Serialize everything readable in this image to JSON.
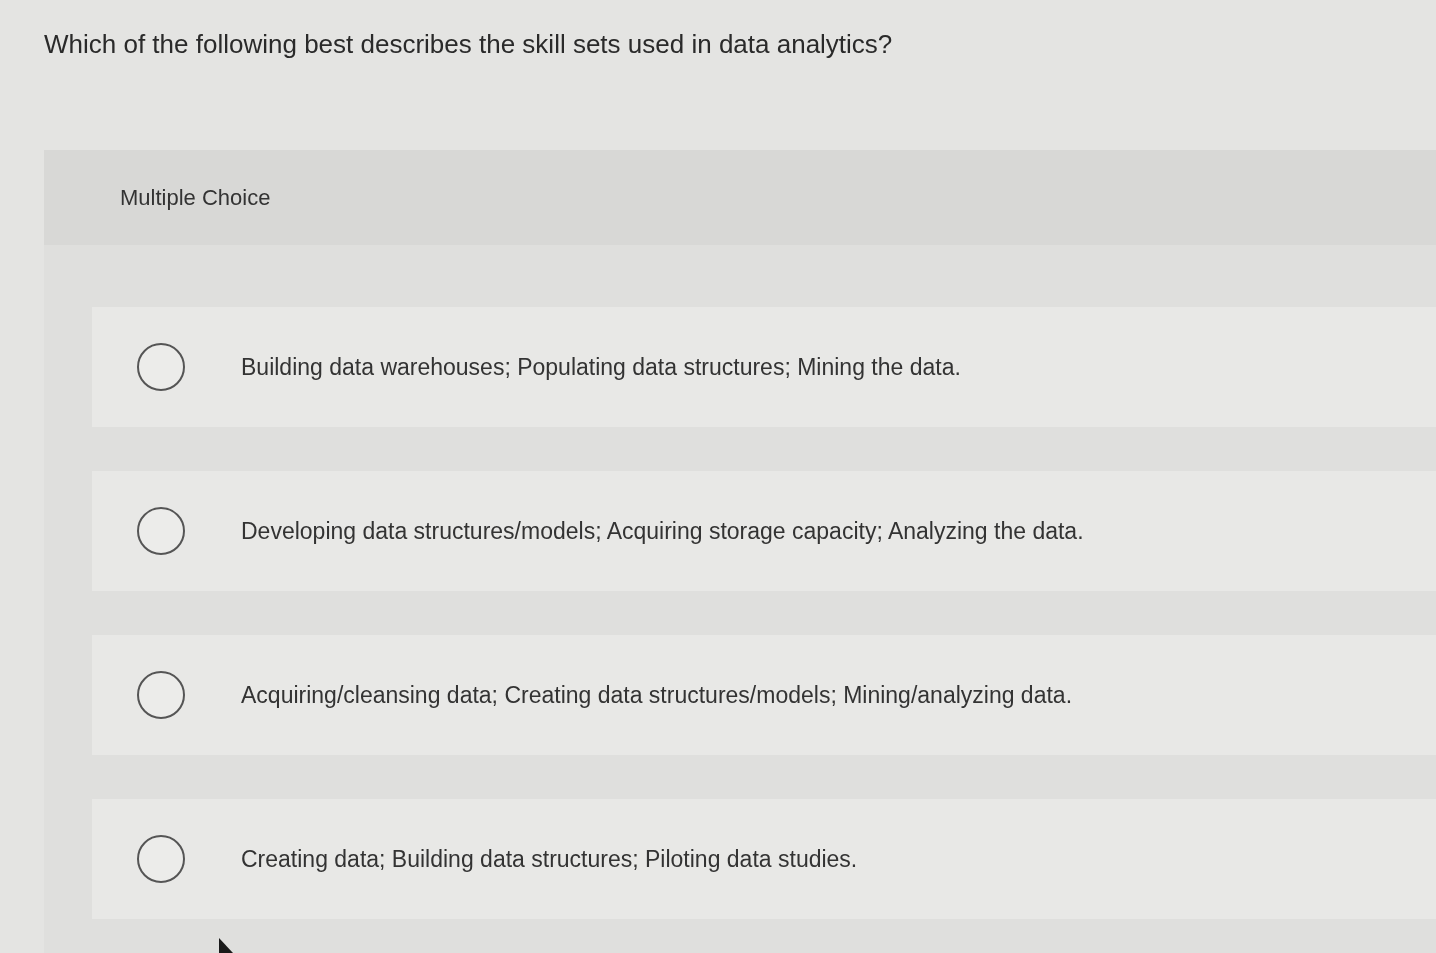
{
  "question": "Which of the following best describes the skill sets used in data analytics?",
  "panel": {
    "label": "Multiple Choice",
    "options": [
      {
        "text": "Building data warehouses; Populating data structures; Mining the data.",
        "selected": false
      },
      {
        "text": "Developing data structures/models; Acquiring storage capacity; Analyzing the data.",
        "selected": false
      },
      {
        "text": "Acquiring/cleansing data; Creating data structures/models; Mining/analyzing data.",
        "selected": false
      },
      {
        "text": "Creating data; Building data structures; Piloting data studies.",
        "selected": false
      }
    ]
  }
}
